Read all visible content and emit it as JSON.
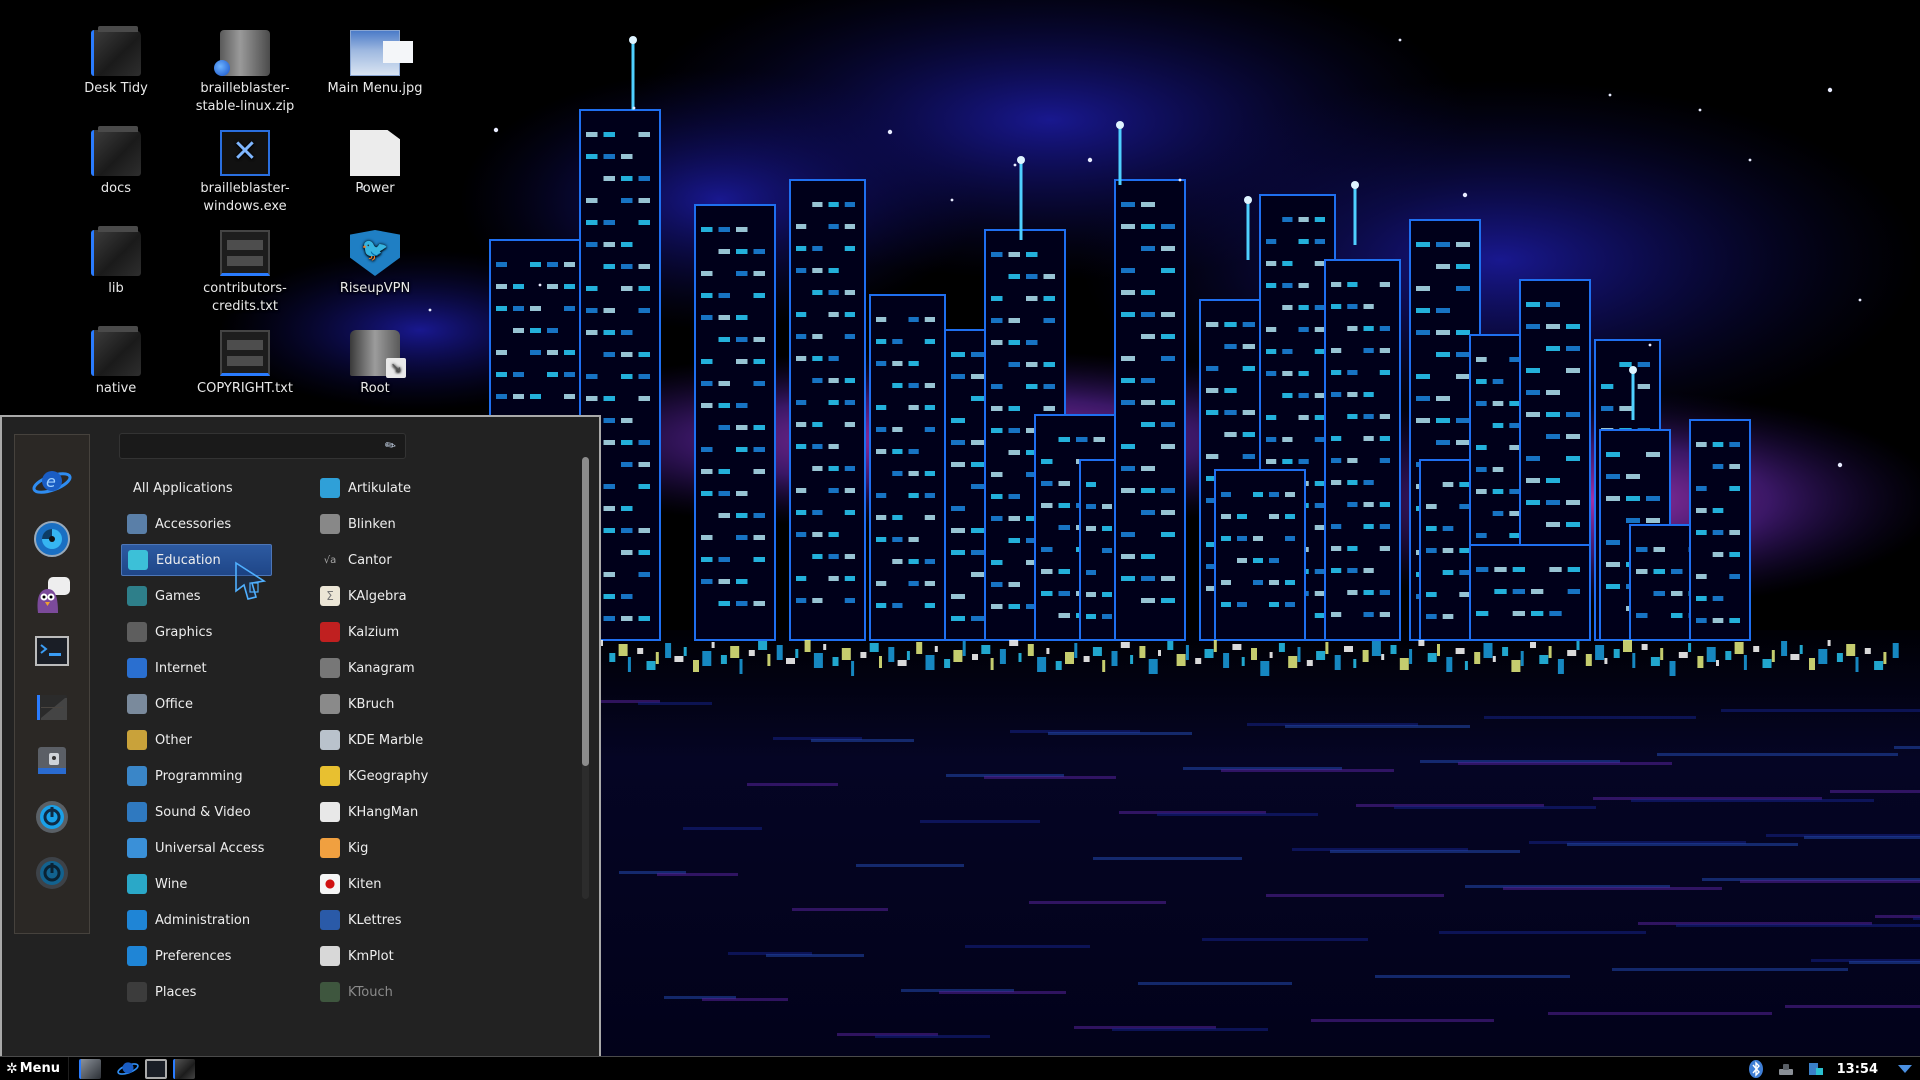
{
  "desktop": {
    "icons": [
      {
        "label": "Desk Tidy",
        "icon": "folder-icon"
      },
      {
        "label": "brailleblaster-stable-linux.zip",
        "icon": "archive-icon"
      },
      {
        "label": "Main Menu.jpg",
        "icon": "image-file-icon"
      },
      {
        "label": "docs",
        "icon": "folder-icon"
      },
      {
        "label": "brailleblaster-windows.exe",
        "icon": "executable-icon"
      },
      {
        "label": "Power",
        "icon": "blank-file-icon"
      },
      {
        "label": "lib",
        "icon": "folder-icon"
      },
      {
        "label": "contributors-credits.txt",
        "icon": "text-file-icon"
      },
      {
        "label": "RiseupVPN",
        "icon": "riseupvpn-icon"
      },
      {
        "label": "native",
        "icon": "folder-icon"
      },
      {
        "label": "COPYRIGHT.txt",
        "icon": "text-file-icon"
      },
      {
        "label": "Root",
        "icon": "root-filesystem-icon"
      }
    ]
  },
  "menu": {
    "search": {
      "value": "",
      "placeholder": ""
    },
    "favorites": [
      {
        "name": "web-browser",
        "icon": "browser-icon"
      },
      {
        "name": "system-settings",
        "icon": "settings-icon"
      },
      {
        "name": "chat-client",
        "icon": "pidgin-icon"
      },
      {
        "name": "terminal",
        "icon": "terminal-icon"
      },
      {
        "name": "file-manager",
        "icon": "folder-icon"
      },
      {
        "name": "lock-screen",
        "icon": "lock-icon"
      },
      {
        "name": "logout",
        "icon": "logout-icon"
      },
      {
        "name": "shutdown",
        "icon": "power-icon"
      }
    ],
    "categories": [
      {
        "label": "All Applications",
        "icon": ""
      },
      {
        "label": "Accessories",
        "icon": "accessories-icon"
      },
      {
        "label": "Education",
        "icon": "education-icon",
        "selected": true
      },
      {
        "label": "Games",
        "icon": "games-icon"
      },
      {
        "label": "Graphics",
        "icon": "graphics-icon"
      },
      {
        "label": "Internet",
        "icon": "internet-icon"
      },
      {
        "label": "Office",
        "icon": "office-icon"
      },
      {
        "label": "Other",
        "icon": "other-icon"
      },
      {
        "label": "Programming",
        "icon": "programming-icon"
      },
      {
        "label": "Sound & Video",
        "icon": "sound-video-icon"
      },
      {
        "label": "Universal Access",
        "icon": "universal-access-icon"
      },
      {
        "label": "Wine",
        "icon": "wine-icon"
      },
      {
        "label": "Administration",
        "icon": "administration-icon"
      },
      {
        "label": "Preferences",
        "icon": "preferences-icon"
      },
      {
        "label": "Places",
        "icon": "places-icon"
      }
    ],
    "applications": [
      {
        "label": "Artikulate",
        "icon": "artikulate-icon"
      },
      {
        "label": "Blinken",
        "icon": "blinken-icon"
      },
      {
        "label": "Cantor",
        "icon": "cantor-icon"
      },
      {
        "label": "KAlgebra",
        "icon": "kalgebra-icon"
      },
      {
        "label": "Kalzium",
        "icon": "kalzium-icon"
      },
      {
        "label": "Kanagram",
        "icon": "kanagram-icon"
      },
      {
        "label": "KBruch",
        "icon": "kbruch-icon"
      },
      {
        "label": "KDE Marble",
        "icon": "marble-icon"
      },
      {
        "label": "KGeography",
        "icon": "kgeography-icon"
      },
      {
        "label": "KHangMan",
        "icon": "khangman-icon"
      },
      {
        "label": "Kig",
        "icon": "kig-icon"
      },
      {
        "label": "Kiten",
        "icon": "kiten-icon"
      },
      {
        "label": "KLettres",
        "icon": "klettres-icon"
      },
      {
        "label": "KmPlot",
        "icon": "kmplot-icon"
      },
      {
        "label": "KTouch",
        "icon": "ktouch-icon",
        "dim": true
      }
    ],
    "scroll": {
      "visible_fraction": 0.7,
      "position": 0.0
    }
  },
  "taskbar": {
    "menu_label": "Menu",
    "launchers": [
      {
        "name": "show-desktop",
        "icon": "show-desktop-icon"
      },
      {
        "name": "web-browser",
        "icon": "browser-icon"
      },
      {
        "name": "terminal",
        "icon": "terminal-icon"
      },
      {
        "name": "file-manager",
        "icon": "folder-icon"
      }
    ],
    "tray": [
      {
        "name": "bluetooth",
        "icon": "bluetooth-icon"
      },
      {
        "name": "network",
        "icon": "network-icon"
      },
      {
        "name": "update-manager",
        "icon": "update-icon"
      }
    ],
    "clock": "13:54"
  },
  "colors": {
    "menu_bg": "#222222",
    "selection": "#2d5aa1",
    "accent_blue": "#2a7cff",
    "neon_cyan": "#27c3f0"
  }
}
